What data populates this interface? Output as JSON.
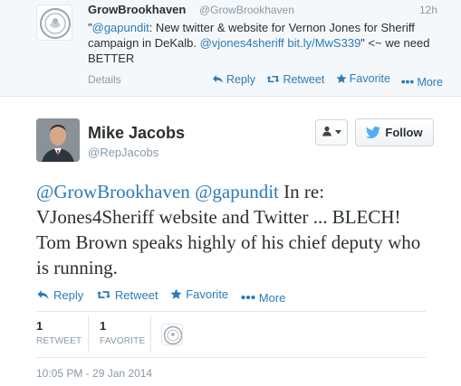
{
  "parent_tweet": {
    "name": "GrowBrookhaven",
    "handle": "@GrowBrookhaven",
    "time": "12h",
    "text_parts": {
      "mention": "@gapundit",
      "t1": ": New twitter & website for Vernon Jones for Sheriff campaign in DeKalb. ",
      "mention2": "@vjones4sheriff",
      "t2": " ",
      "link": "bit.ly/MwS339",
      "t3": "\" <~ we need BETTER"
    },
    "quote_open": "\"",
    "details_label": "Details",
    "actions": {
      "reply": "Reply",
      "retweet": "Retweet",
      "favorite": "Favorite",
      "more": "More"
    }
  },
  "main_tweet": {
    "name": "Mike Jacobs",
    "handle": "@RepJacobs",
    "follow_label": "Follow",
    "text_parts": {
      "mention1": "@GrowBrookhaven",
      "space": " ",
      "mention2": "@gapundit",
      "body": " In re: VJones4Sheriff website and Twitter ... BLECH! Tom Brown speaks highly of his chief deputy who is running."
    },
    "actions": {
      "reply": "Reply",
      "retweet": "Retweet",
      "favorite": "Favorite",
      "more": "More"
    },
    "stats": {
      "retweets_count": "1",
      "retweets_label": "RETWEET",
      "favorites_count": "1",
      "favorites_label": "FAVORITE"
    },
    "timestamp": "10:05 PM - 29 Jan 2014"
  },
  "colors": {
    "link": "#2b7bb9",
    "muted": "#8899a6",
    "text": "#292f33",
    "parent_bg": "#f5f8fa"
  },
  "icons": [
    "seal-icon",
    "reply-icon",
    "retweet-icon",
    "star-icon",
    "more-dots-icon",
    "person-icon",
    "chevron-down-icon",
    "twitter-bird-icon"
  ]
}
